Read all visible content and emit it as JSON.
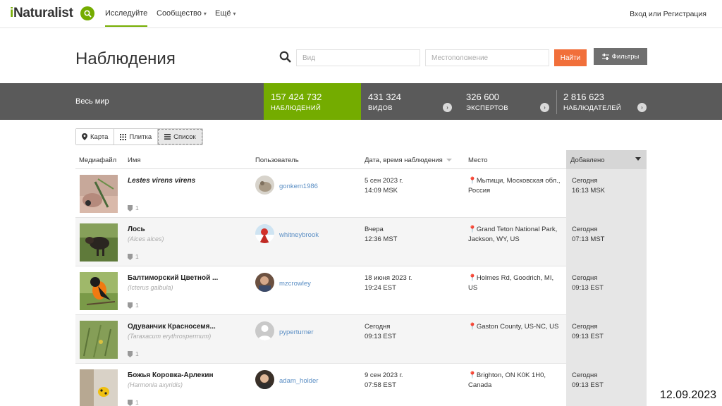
{
  "app": {
    "logo_i": "i",
    "logo_rest": "Naturalist",
    "nav": [
      {
        "label": "Исследуйте"
      },
      {
        "label": "Сообщество"
      },
      {
        "label": "Ещё"
      }
    ],
    "auth": "Вход или Регистрация"
  },
  "header": {
    "title": "Наблюдения",
    "species_placeholder": "Вид",
    "location_placeholder": "Местоположение",
    "find_label": "Найти",
    "filters_label": "Фильтры"
  },
  "stats": {
    "place": "Весь мир",
    "items": [
      {
        "number": "157 424 732",
        "label": "НАБЛЮДЕНИЙ"
      },
      {
        "number": "431 324",
        "label": "ВИДОВ"
      },
      {
        "number": "326 600",
        "label": "ЭКСПЕРТОВ"
      },
      {
        "number": "2 816 623",
        "label": "НАБЛЮДАТЕЛЕЙ"
      }
    ]
  },
  "views": [
    {
      "label": "Карта"
    },
    {
      "label": "Плитка"
    },
    {
      "label": "Список"
    }
  ],
  "table": {
    "columns": {
      "media": "Медиафайл",
      "name": "Имя",
      "user": "Пользователь",
      "date": "Дата, время наблюдения",
      "place": "Место",
      "added": "Добавлено"
    },
    "rows": [
      {
        "name": "Lestes virens virens",
        "sci": "",
        "ids": "1",
        "user": "gonkem1986",
        "date1": "5 сен 2023 г.",
        "date2": "14:09 MSK",
        "place": "Мытищи, Московская обл., Россия",
        "added1": "Сегодня",
        "added2": "16:13 MSK"
      },
      {
        "name": "Лось",
        "sci": "(Alces alces)",
        "ids": "1",
        "user": "whitneybrook",
        "date1": "Вчера",
        "date2": "12:36 MST",
        "place": "Grand Teton National Park, Jackson, WY, US",
        "added1": "Сегодня",
        "added2": "07:13 MST"
      },
      {
        "name": "Балтиморский Цветной ...",
        "sci": "(Icterus galbula)",
        "ids": "1",
        "user": "mzcrowley",
        "date1": "18 июня 2023 г.",
        "date2": "19:24 EST",
        "place": "Holmes Rd, Goodrich, MI, US",
        "added1": "Сегодня",
        "added2": "09:13 EST"
      },
      {
        "name": "Одуванчик Красносемя...",
        "sci": "(Taraxacum erythrospermum)",
        "ids": "1",
        "user": "pyperturner",
        "date1": "Сегодня",
        "date2": "09:13 EST",
        "place": "Gaston County, US-NC, US",
        "added1": "Сегодня",
        "added2": "09:13 EST"
      },
      {
        "name": "Божья Коровка-Арлекин",
        "sci": "(Harmonia axyridis)",
        "ids": "1",
        "user": "adam_holder",
        "date1": "9 сен 2023 г.",
        "date2": "07:58 EST",
        "place": "Brighton, ON K0K 1H0, Canada",
        "added1": "Сегодня",
        "added2": "09:13 EST"
      }
    ]
  },
  "overlay_date": "12.09.2023",
  "colors": {
    "accent": "#74ac00",
    "find": "#f16f3a",
    "stats_bg": "#5a5a5a"
  }
}
